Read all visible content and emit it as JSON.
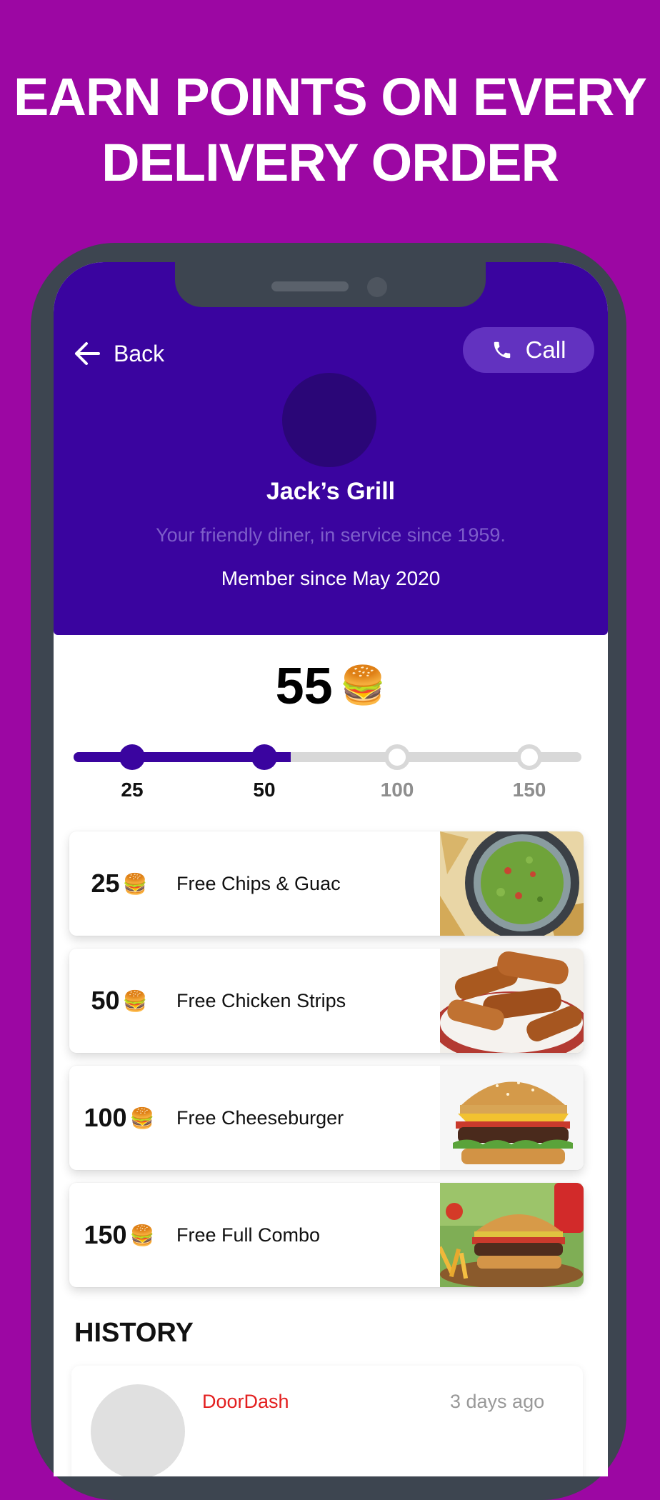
{
  "headline": {
    "line1": "EARN POINTS ON EVERY",
    "line2": "DELIVERY ORDER"
  },
  "colors": {
    "background": "#9c07a3",
    "brand": "#3a049f",
    "call_button": "#6232c0",
    "phone_frame": "#3d4550",
    "history_source": "#e31f1f"
  },
  "header": {
    "back_label": "Back",
    "call_label": "Call",
    "business_name": "Jack’s Grill",
    "tagline": "Your friendly diner, in service since 1959.",
    "member_since": "Member since May 2020"
  },
  "points": {
    "value": "55",
    "emoji": "🍔"
  },
  "progress": {
    "milestones": [
      "25",
      "50",
      "100",
      "150"
    ],
    "reached_count": 2
  },
  "rewards": [
    {
      "points": "25",
      "emoji": "🍔",
      "label": "Free Chips & Guac"
    },
    {
      "points": "50",
      "emoji": "🍔",
      "label": "Free Chicken Strips"
    },
    {
      "points": "100",
      "emoji": "🍔",
      "label": "Free Cheeseburger"
    },
    {
      "points": "150",
      "emoji": "🍔",
      "label": "Free Full Combo"
    }
  ],
  "history": {
    "title": "HISTORY",
    "items": [
      {
        "source": "DoorDash",
        "time": "3 days ago"
      }
    ]
  }
}
